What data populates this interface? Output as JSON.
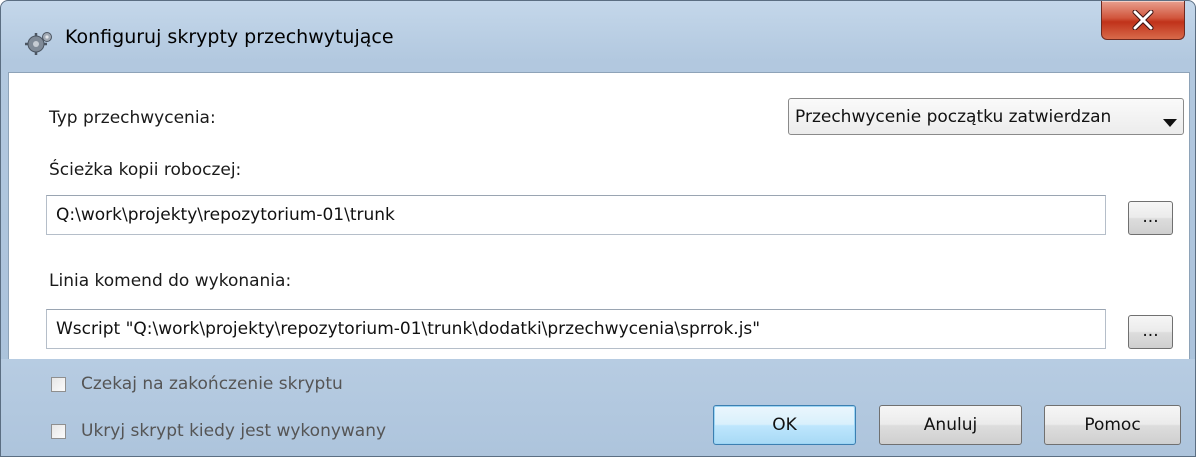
{
  "window": {
    "title": "Konfiguruj skrypty przechwytujące",
    "icon": "gears-icon",
    "close_icon": "close-icon"
  },
  "form": {
    "hook_type_label": "Typ przechwycenia:",
    "hook_type_value": "Przechwycenie początku zatwierdzan",
    "working_copy_label": "Ścieżka kopii roboczej:",
    "working_copy_value": "Q:\\work\\projekty\\repozytorium-01\\trunk",
    "browse_label": "...",
    "command_label": "Linia komend do wykonania:",
    "command_value": "Wscript \"Q:\\work\\projekty\\repozytorium-01\\trunk\\dodatki\\przechwycenia\\sprrok.js\"",
    "browse2_label": "..."
  },
  "options": {
    "wait_label": "Czekaj na zakończenie skryptu",
    "wait_checked": false,
    "hide_label": "Ukryj skrypt kiedy jest wykonywany",
    "hide_checked": false
  },
  "buttons": {
    "ok": "OK",
    "cancel": "Anuluj",
    "help": "Pomoc"
  },
  "colors": {
    "titlebar": "#b8cde3",
    "close_button": "#c94a30",
    "default_button": "#bee6fd"
  }
}
